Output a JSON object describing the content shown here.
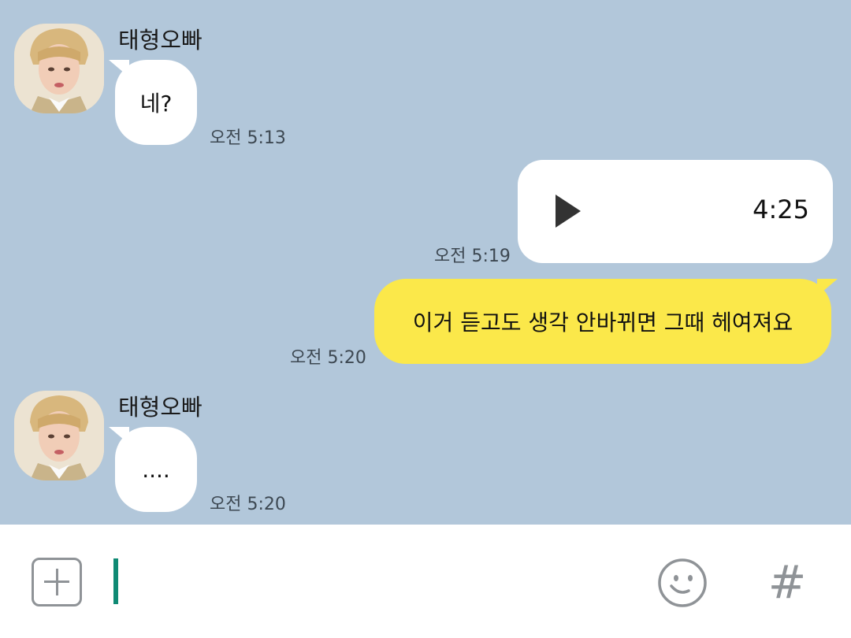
{
  "messages": [
    {
      "sender": "태형오빠",
      "text": "네?",
      "time": "오전 5:13"
    },
    {
      "type": "voice",
      "duration": "4:25",
      "time": "오전 5:19"
    },
    {
      "text": "이거 듣고도 생각 안바뀌면 그때 헤여져요",
      "time": "오전 5:20"
    },
    {
      "sender": "태형오빠",
      "text": "....",
      "time": "오전 5:20"
    }
  ],
  "input_bar": {
    "hash_label": "#",
    "icons": [
      "plus-icon",
      "emoji-icon",
      "hash-icon"
    ]
  },
  "colors": {
    "chat_background": "#b2c7da",
    "outgoing_bubble": "#fbe84a",
    "incoming_bubble": "#ffffff",
    "cursor": "#0f8a74"
  }
}
